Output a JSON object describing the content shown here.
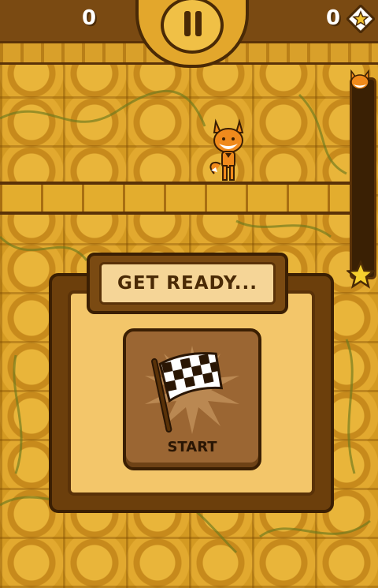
{
  "hud": {
    "left_counter": "0",
    "right_counter": "0",
    "pause_icon": "pause-icon",
    "gem_icon": "diamond-star-icon"
  },
  "level_progress": {
    "fraction": 0.0,
    "marker_icon": "fox-head-icon",
    "goal_icon": "star-icon"
  },
  "dialog": {
    "title": "GET READY...",
    "start_label": "START",
    "start_icon": "checkered-flag-icon"
  },
  "colors": {
    "wall": "#d49a22",
    "panel_dark": "#6c3f0c",
    "panel_light": "#f3c66a",
    "banner_light": "#f5d597",
    "text_dark": "#4a2a06",
    "fox_orange": "#f08a1c"
  }
}
